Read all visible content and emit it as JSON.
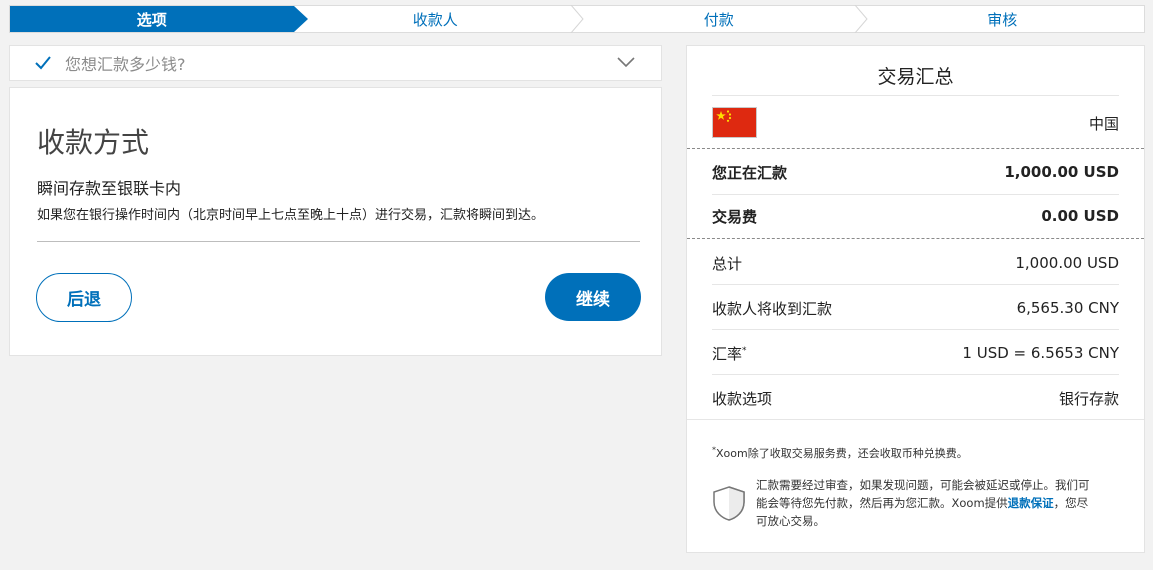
{
  "stepper": {
    "steps": [
      "选项",
      "收款人",
      "付款",
      "审核"
    ]
  },
  "amount_section": {
    "label": "您想汇款多少钱?"
  },
  "method_section": {
    "title": "收款方式",
    "option_title": "瞬间存款至银联卡内",
    "option_desc": "如果您在银行操作时间内（北京时间早上七点至晚上十点）进行交易，汇款将瞬间到达。",
    "back_label": "后退",
    "continue_label": "继续"
  },
  "summary": {
    "title": "交易汇总",
    "country": "中国",
    "sending_label": "您正在汇款",
    "sending_value": "1,000.00 USD",
    "fee_label": "交易费",
    "fee_value": "0.00 USD",
    "total_label": "总计",
    "total_value": "1,000.00 USD",
    "receive_label": "收款人将收到汇款",
    "receive_value": "6,565.30 CNY",
    "rate_label": "汇率",
    "rate_mark": "*",
    "rate_value": "1 USD = 6.5653 CNY",
    "option_label": "收款选项",
    "option_value": "银行存款",
    "footnote_mark": "*",
    "footnote": "Xoom除了收取交易服务费，还会收取币种兑换费。",
    "guarantee_text": "汇款需要经过审查，如果发现问题，可能会被延迟或停止。我们可能会等待您先付款，然后再为您汇款。Xoom提供",
    "guarantee_link": "退款保证",
    "guarantee_tail": "，您尽可放心交易。"
  },
  "colors": {
    "accent": "#0070ba",
    "background": "#f2f2f2",
    "flag_red": "#de2910",
    "flag_yellow": "#ffde00"
  },
  "icons": {
    "check": "check-icon",
    "chevron": "chevron-down-icon",
    "flag": "china-flag-icon",
    "shield": "shield-icon"
  }
}
